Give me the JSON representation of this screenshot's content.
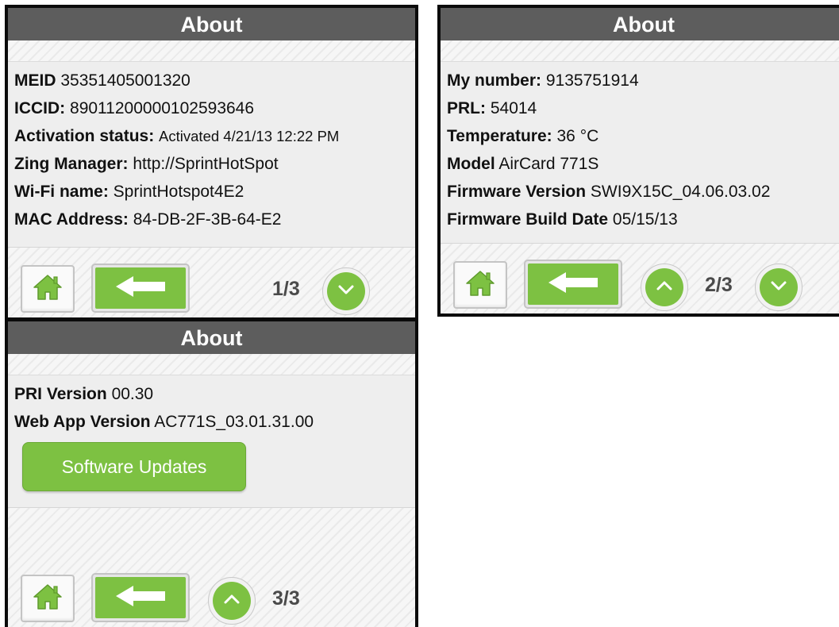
{
  "colors": {
    "accent_green": "#7dc142",
    "title_bar": "#5d5d5d",
    "panel_bg": "#eeeeee"
  },
  "icons": {
    "home": "home-icon",
    "back": "arrow-left-icon",
    "up": "chevron-up-icon",
    "down": "chevron-down-icon"
  },
  "panels": [
    {
      "title": "About",
      "rows": [
        {
          "label": "MEID",
          "value": "35351405001320"
        },
        {
          "label": "ICCID:",
          "value": "89011200000102593646"
        },
        {
          "label": "Activation status:",
          "value": "Activated 4/21/13 12:22 PM"
        },
        {
          "label": "Zing Manager:",
          "value": "http://SprintHotSpot"
        },
        {
          "label": "Wi-Fi name:",
          "value": "SprintHotspot4E2"
        },
        {
          "label": "MAC Address:",
          "value": "84-DB-2F-3B-64-E2"
        }
      ],
      "page": "1/3"
    },
    {
      "title": "About",
      "rows": [
        {
          "label": "My number:",
          "value": "9135751914"
        },
        {
          "label": "PRL:",
          "value": "54014"
        },
        {
          "label": "Temperature:",
          "value": "36 °C"
        },
        {
          "label": "Model",
          "value": "AirCard 771S"
        },
        {
          "label": "Firmware Version",
          "value": "SWI9X15C_04.06.03.02"
        },
        {
          "label": "Firmware Build Date",
          "value": "05/15/13"
        }
      ],
      "page": "2/3"
    },
    {
      "title": "About",
      "rows": [
        {
          "label": "PRI Version",
          "value": "00.30"
        },
        {
          "label": "Web App Version",
          "value": "AC771S_03.01.31.00"
        }
      ],
      "button": "Software Updates",
      "page": "3/3"
    }
  ]
}
